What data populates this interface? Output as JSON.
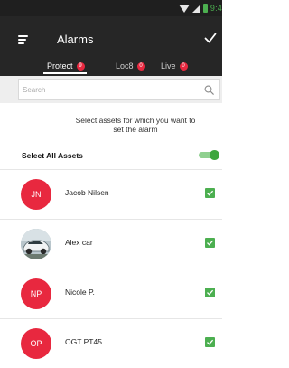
{
  "status_bar": {
    "time": "9:4"
  },
  "header": {
    "title": "Alarms"
  },
  "tabs": [
    {
      "label": "Protect",
      "badge": "9"
    },
    {
      "label": "Loc8",
      "badge": "0"
    },
    {
      "label": "Live",
      "badge": "0"
    }
  ],
  "search": {
    "placeholder": "Search"
  },
  "instruction": "Select assets for which you want to set the alarm",
  "select_all": {
    "label": "Select All Assets",
    "enabled": true
  },
  "assets": [
    {
      "initials": "JN",
      "name": "Jacob Nilsen",
      "checked": true
    },
    {
      "initials": "",
      "name": "Alex car",
      "checked": true
    },
    {
      "initials": "NP",
      "name": "Nicole P.",
      "checked": true
    },
    {
      "initials": "OP",
      "name": "OGT PT45",
      "checked": true
    }
  ],
  "colors": {
    "app_bar": "#262626",
    "accent_red": "#e8283f",
    "check_green": "#4caf50"
  }
}
